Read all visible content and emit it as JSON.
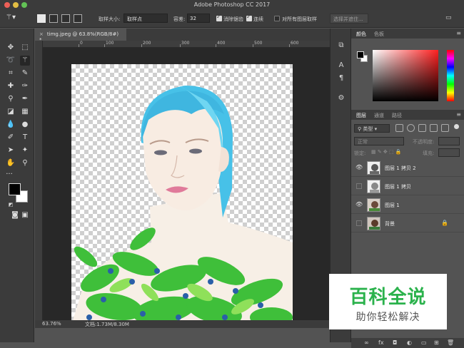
{
  "window": {
    "title": "Adobe Photoshop CC 2017"
  },
  "options_bar": {
    "sample_size_label": "取样大小:",
    "sample_size_value": "取样点",
    "tolerance_label": "容差:",
    "tolerance_value": "32",
    "antialias_label": "消除锯齿",
    "antialias_checked": true,
    "contiguous_label": "连续",
    "contiguous_checked": true,
    "all_layers_label": "对所有图层取样",
    "all_layers_checked": false,
    "select_mask_label": "选择并遮住..."
  },
  "document": {
    "tab_title": "timg.jpeg @ 63.8%(RGB/8#) *",
    "ruler_labels": [
      "0",
      "100",
      "200",
      "300",
      "400",
      "500",
      "600"
    ]
  },
  "status": {
    "zoom": "63.76%",
    "doc_info": "文档:1.73M/8.30M"
  },
  "color_panel": {
    "tabs": [
      "颜色",
      "色板"
    ],
    "active_tab": 0
  },
  "layers_panel": {
    "tabs": [
      "图层",
      "通道",
      "路径"
    ],
    "active_tab": 0,
    "filter_kind": "类型",
    "blend_mode": "正常",
    "opacity_label": "不透明度:",
    "lock_label": "锁定:",
    "fill_label": "填充:",
    "layers": [
      {
        "name": "图层 1 拷贝 2",
        "visible": true,
        "locked": false
      },
      {
        "name": "图层 1 拷贝",
        "visible": false,
        "locked": false
      },
      {
        "name": "图层 1",
        "visible": true,
        "locked": false
      },
      {
        "name": "背景",
        "visible": false,
        "locked": true
      }
    ],
    "footer_icons": [
      "link-icon",
      "fx-icon",
      "mask-icon",
      "adjustment-icon",
      "folder-icon",
      "new-layer-icon",
      "trash-icon"
    ]
  },
  "watermark": {
    "title": "百科全说",
    "subtitle": "助你轻松解决"
  },
  "colors": {
    "foreground": "#000000",
    "background": "#ffffff",
    "watermark_green": "#2bb24c"
  }
}
